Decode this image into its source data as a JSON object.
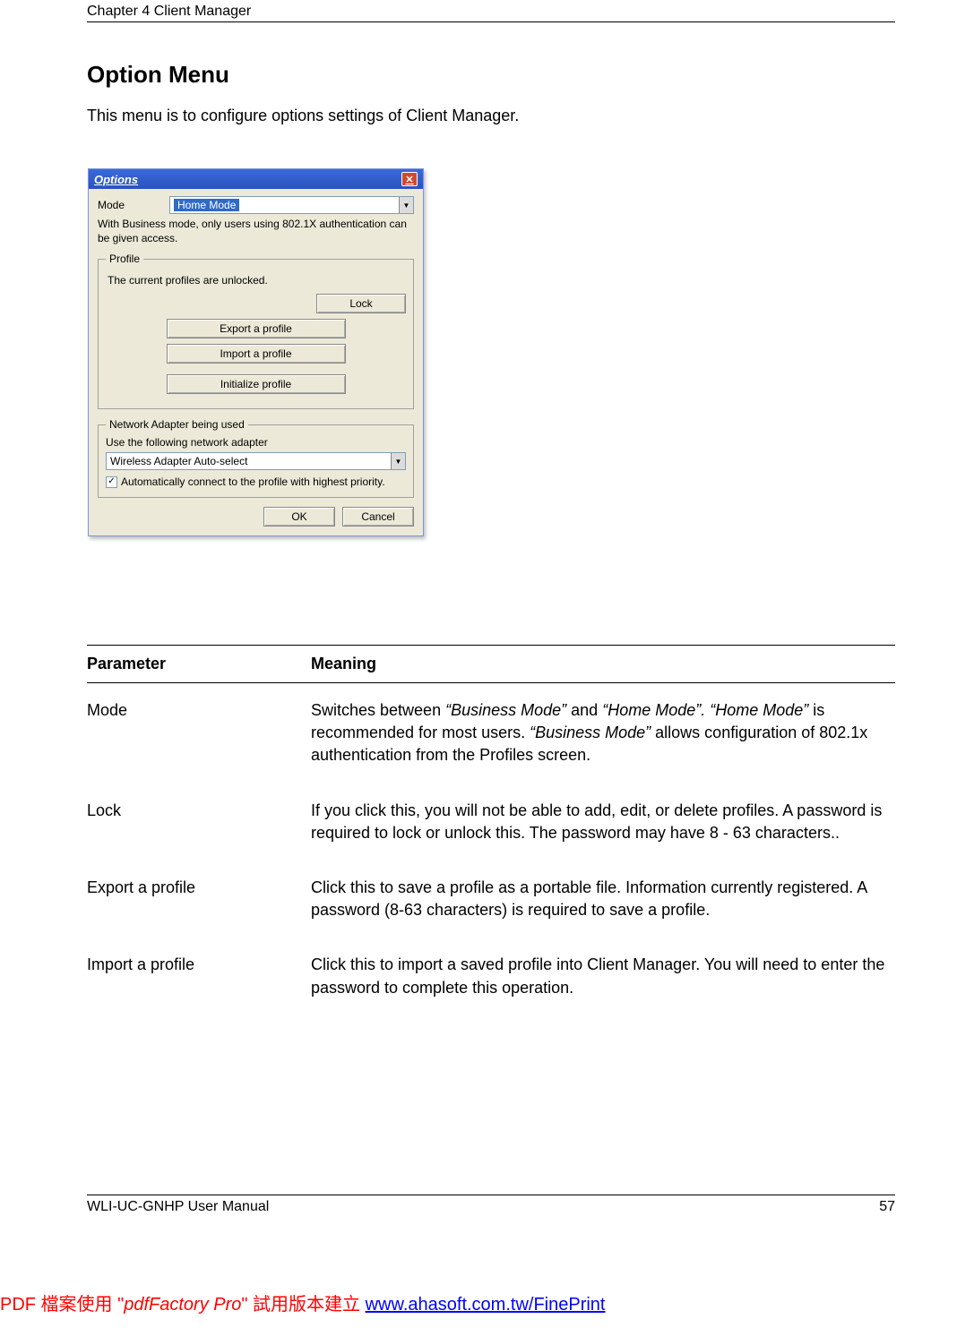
{
  "header": {
    "chapter": "Chapter 4  Client Manager"
  },
  "section": {
    "title": "Option Menu",
    "intro": "This menu is to configure options settings of Client Manager."
  },
  "dialog": {
    "title": "Options",
    "mode_label": "Mode",
    "mode_value": "Home Mode",
    "mode_hint": "With Business mode, only users using 802.1X authentication can be given access.",
    "profile_legend": "Profile",
    "profile_status": "The current profiles are unlocked.",
    "lock_btn": "Lock",
    "export_btn": "Export a profile",
    "import_btn": "Import a profile",
    "init_btn": "Initialize profile",
    "na_legend": "Network Adapter being used",
    "na_label": "Use the following network adapter",
    "na_value": "Wireless Adapter Auto-select",
    "auto_chk": "Automatically connect to the profile with highest priority.",
    "ok": "OK",
    "cancel": "Cancel"
  },
  "table": {
    "h_param": "Parameter",
    "h_meaning": "Meaning",
    "rows": [
      {
        "param": "Mode",
        "meaning_pre": "Switches between ",
        "it1": "“Business Mode”",
        "mid1": " and ",
        "it2": "“Home Mode”.  “Home Mode”",
        "mid2": " is recommended for most users. ",
        "it3": "“Business Mode”",
        "post": " allows configuration of 802.1x authentication from the Profiles screen."
      },
      {
        "param": "Lock",
        "meaning": "If you click this, you will not be able to add, edit, or delete profiles. A password is required to lock or unlock this.  The password may have 8 - 63 characters.."
      },
      {
        "param": "Export a profile",
        "meaning": "Click this to save a profile as a portable file.  Information currently registered.  A password (8-63 characters) is required to save a profile."
      },
      {
        "param": "Import a profile",
        "meaning": "Click this to import a saved profile into Client Manager.  You will need to enter the password to complete this operation."
      }
    ]
  },
  "footer": {
    "manual": "WLI-UC-GNHP User Manual",
    "page": "57"
  },
  "watermark": {
    "pre": "PDF 檔案使用 \"",
    "italic": "pdfFactory Pro",
    "mid": "\" 試用版本建立 ",
    "link": "www.ahasoft.com.tw/FinePrint"
  }
}
